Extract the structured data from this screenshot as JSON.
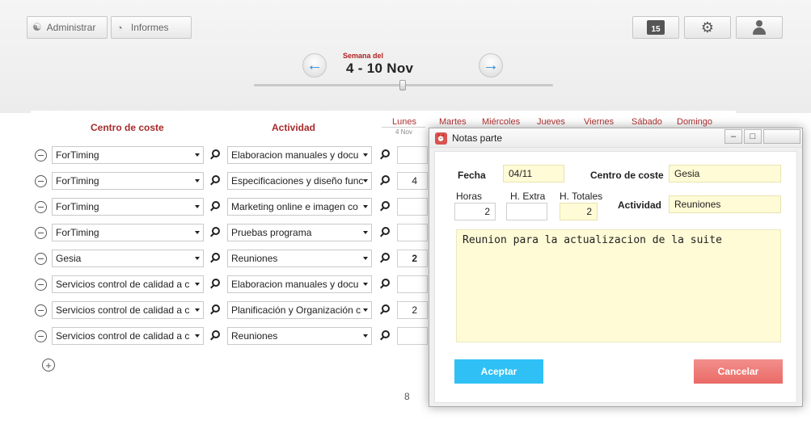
{
  "toolbar": {
    "administrar_label": "Administrar",
    "informes_label": "Informes",
    "calendar_day": "15"
  },
  "week": {
    "label": "Semana del",
    "range": "4 - 10 Nov"
  },
  "grid": {
    "col_centro": "Centro de coste",
    "col_actividad": "Actividad",
    "days": [
      {
        "name": "Lunes",
        "date": "4 Nov"
      },
      {
        "name": "Martes",
        "date": ""
      },
      {
        "name": "Miércoles",
        "date": ""
      },
      {
        "name": "Jueves",
        "date": ""
      },
      {
        "name": "Viernes",
        "date": ""
      },
      {
        "name": "Sábado",
        "date": ""
      },
      {
        "name": "Domingo",
        "date": ""
      }
    ],
    "rows": [
      {
        "centro": "ForTiming",
        "actividad": "Elaboracion manuales y docu",
        "lunes": ""
      },
      {
        "centro": "ForTiming",
        "actividad": "Especificaciones y diseño func",
        "lunes": "4"
      },
      {
        "centro": "ForTiming",
        "actividad": "Marketing online e imagen co",
        "lunes": ""
      },
      {
        "centro": "ForTiming",
        "actividad": "Pruebas programa",
        "lunes": ""
      },
      {
        "centro": "Gesia",
        "actividad": "Reuniones",
        "lunes": "2"
      },
      {
        "centro": "Servicios control de calidad a c",
        "actividad": "Elaboracion manuales y docu",
        "lunes": ""
      },
      {
        "centro": "Servicios control de calidad a c",
        "actividad": "Planificación y Organización c",
        "lunes": "2"
      },
      {
        "centro": "Servicios control de calidad a c",
        "actividad": "Reuniones",
        "lunes": ""
      }
    ],
    "page_total": "8"
  },
  "dialog": {
    "title": "Notas parte",
    "fecha_label": "Fecha",
    "fecha_value": "04/11",
    "centro_label": "Centro de coste",
    "centro_value": "Gesia",
    "horas_label": "Horas",
    "horas_value": "2",
    "hextra_label": "H. Extra",
    "hextra_value": "",
    "htotales_label": "H. Totales",
    "htotales_value": "2",
    "actividad_label": "Actividad",
    "actividad_value": "Reuniones",
    "notes_text": "Reunion para la actualizacion de la suite",
    "accept_label": "Aceptar",
    "cancel_label": "Cancelar"
  },
  "colors": {
    "accent_red": "#a62a2a",
    "accept_blue": "#2fc0f5",
    "cancel_red": "#ea6a66",
    "note_yellow": "#fffbd6"
  }
}
